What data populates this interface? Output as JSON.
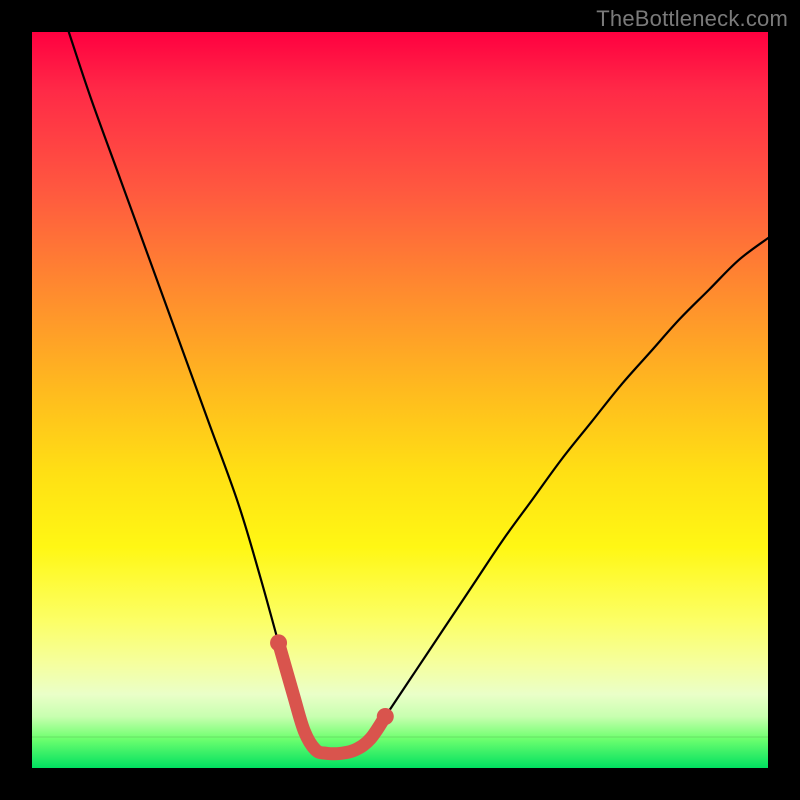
{
  "watermark": "TheBottleneck.com",
  "chart_data": {
    "type": "line",
    "title": "",
    "xlabel": "",
    "ylabel": "",
    "xlim": [
      0,
      100
    ],
    "ylim": [
      0,
      100
    ],
    "notes": "Bottleneck curve: V-shape. Background hue encodes bottleneck severity (red high, green low). Black curve shows bottleneck %, coral segment marks sweet-spot near minimum.",
    "series": [
      {
        "name": "bottleneck-curve",
        "color": "#000000",
        "x": [
          5,
          8,
          12,
          16,
          20,
          24,
          28,
          31,
          33.5,
          35.5,
          37,
          38.5,
          40,
          42,
          44,
          46,
          48,
          52,
          56,
          60,
          64,
          68,
          72,
          76,
          80,
          84,
          88,
          92,
          96,
          100
        ],
        "y": [
          100,
          91,
          80,
          69,
          58,
          47,
          36,
          26,
          17,
          10,
          5,
          2.5,
          2,
          2,
          2.5,
          4,
          7,
          13,
          19,
          25,
          31,
          36.5,
          42,
          47,
          52,
          56.5,
          61,
          65,
          69,
          72
        ]
      },
      {
        "name": "sweet-spot",
        "color": "#d9544d",
        "x": [
          33.5,
          35.5,
          37,
          38.5,
          40,
          42,
          44,
          46,
          48
        ],
        "y": [
          17,
          10,
          5,
          2.5,
          2,
          2,
          2.5,
          4,
          7
        ]
      }
    ]
  }
}
